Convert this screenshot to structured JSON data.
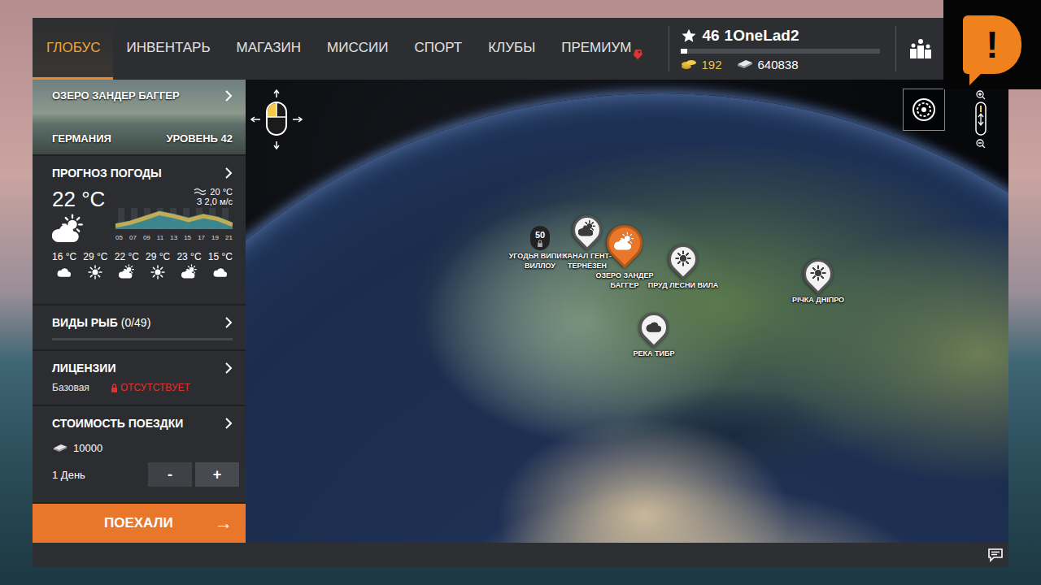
{
  "logo": {
    "mark": "!"
  },
  "nav": {
    "tabs": [
      {
        "label": "ГЛОБУС",
        "selected": true
      },
      {
        "label": "ИНВЕНТАРЬ",
        "selected": false
      },
      {
        "label": "МАГАЗИН",
        "selected": false
      },
      {
        "label": "МИССИИ",
        "selected": false
      },
      {
        "label": "СПОРТ",
        "selected": false
      },
      {
        "label": "КЛУБЫ",
        "selected": false
      },
      {
        "label": "ПРЕМИУМ",
        "selected": false
      }
    ]
  },
  "player": {
    "level": "46",
    "name": "1OneLad2",
    "xp_level": 0.03,
    "gold": "192",
    "silver": "640838"
  },
  "location": {
    "name": "ОЗЕРО ЗАНДЕР БАГГЕР",
    "country": "ГЕРМАНИЯ",
    "level": "УРОВЕНЬ 42"
  },
  "weather": {
    "title": "ПРОГНОЗ ПОГОДЫ",
    "temperature": "22 °C",
    "condition": "partly",
    "water_temperature": "20 °C",
    "wind": "З 2,0 м/с",
    "hours": [
      "05",
      "07",
      "09",
      "11",
      "13",
      "15",
      "17",
      "19",
      "21"
    ],
    "curve": [
      16,
      19,
      24,
      29,
      26,
      22,
      26,
      23,
      17
    ],
    "forecast": [
      {
        "temperature": "16 °C",
        "condition": "cloud"
      },
      {
        "temperature": "29 °C",
        "condition": "sun"
      },
      {
        "temperature": "22 °C",
        "condition": "partly"
      },
      {
        "temperature": "29 °C",
        "condition": "sun"
      },
      {
        "temperature": "23 °C",
        "condition": "partly"
      },
      {
        "temperature": "15 °C",
        "condition": "cloud"
      }
    ]
  },
  "fish": {
    "title": "ВИДЫ РЫБ",
    "count": "(0/49)",
    "level": 0
  },
  "licenses": {
    "title": "ЛИЦЕНЗИИ",
    "name": "Базовая",
    "status": "ОТСУТСТВУЕТ",
    "missing": true
  },
  "trip": {
    "title": "СТОИМОСТЬ ПОЕЗДКИ",
    "cost": "10000",
    "days": "1 День",
    "minus": "-",
    "plus": "+"
  },
  "go_button": {
    "label": "ПОЕХАЛИ",
    "arrow": "→"
  },
  "map": {
    "pins": [
      {
        "label": "УГОДЬЯ ВИПИНГ ВИЛЛОУ",
        "kind": "locked",
        "level": "50",
        "condition": "none",
        "selected": false
      },
      {
        "label": "КАНАЛ ГЕНТ-ТЕРНЁЗЕН",
        "kind": "weather",
        "level": "",
        "condition": "partly",
        "selected": false
      },
      {
        "label": "ОЗЕРО ЗАНДЕР БАГГЕР",
        "kind": "weather",
        "level": "",
        "condition": "partly",
        "selected": true
      },
      {
        "label": "ПРУД ЛЕСНИ ВИЛА",
        "kind": "weather",
        "level": "",
        "condition": "sun",
        "selected": false
      },
      {
        "label": "РІЧКА ДНІПРО",
        "kind": "weather",
        "level": "",
        "condition": "sun",
        "selected": false
      },
      {
        "label": "РЕКА ТИБР",
        "kind": "weather",
        "level": "",
        "condition": "cloud",
        "selected": false
      }
    ]
  }
}
